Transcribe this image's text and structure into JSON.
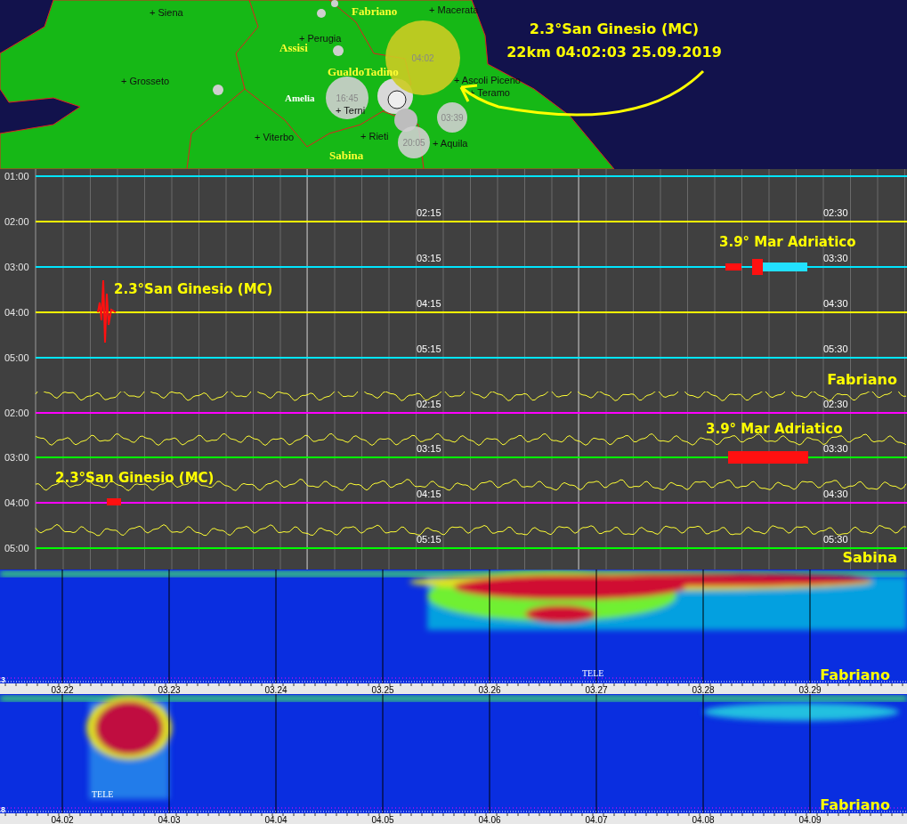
{
  "map": {
    "cities": [
      "+ Siena",
      "+ Macerata",
      "+ Perugia",
      "+ Grosseto",
      "+ Ascoli Piceno",
      "+ Teramo",
      "+ Viterbo",
      "+ Rieti",
      "+ Aquila",
      "+ Terni"
    ],
    "stations": [
      "Fabriano",
      "Assisi",
      "GualdoTadino",
      "Amelia",
      "Sabina"
    ],
    "bubbles": [
      {
        "time": "04:02",
        "kind": "latest"
      },
      {
        "time": "16:45",
        "kind": "past"
      },
      {
        "time": "03:39",
        "kind": "past"
      },
      {
        "time": "20:05",
        "kind": "past"
      }
    ],
    "callout": {
      "line1": "2.3°San Ginesio (MC)",
      "line2": "22km 04:02:03 25.09.2019"
    }
  },
  "helicorders": [
    {
      "station": "Fabriano",
      "wavy": false,
      "rows": [
        {
          "time": "01:00",
          "color": "#00e5ff"
        },
        {
          "time": "02:00",
          "mid": "02:15",
          "end": "02:30",
          "color": "#ffff00"
        },
        {
          "time": "03:00",
          "mid": "03:15",
          "end": "03:30",
          "color": "#00e5ff"
        },
        {
          "time": "04:00",
          "mid": "04:15",
          "end": "04:30",
          "color": "#ffff00"
        },
        {
          "time": "05:00",
          "mid": "05:15",
          "end": "05:30",
          "color": "#00e5ff"
        }
      ],
      "events": [
        "2.3°San Ginesio (MC)",
        "3.9° Mar Adriatico"
      ]
    },
    {
      "station": "Sabina",
      "wavy": true,
      "rows": [
        {
          "time": "02:00",
          "mid": "02:15",
          "end": "02:30",
          "color": "#ff00ff"
        },
        {
          "time": "03:00",
          "mid": "03:15",
          "end": "03:30",
          "color": "#00ff00"
        },
        {
          "time": "04:00",
          "mid": "04:15",
          "end": "04:30",
          "color": "#ff00ff"
        },
        {
          "time": "05:00",
          "mid": "05:15",
          "end": "05:30",
          "color": "#00ff00"
        }
      ],
      "events": [
        "3.9° Mar Adriatico",
        "2.3°San Ginesio (MC)"
      ]
    }
  ],
  "spectrograms": [
    {
      "station": "Fabriano",
      "marker": "TELE",
      "corner": "3",
      "axis_labels": [
        "03.22",
        "03.23",
        "03.24",
        "03.25",
        "03.26",
        "03.27",
        "03.28",
        "03.29"
      ]
    },
    {
      "station": "Fabriano",
      "marker": "TELE",
      "corner": "8",
      "axis_labels": [
        "04.02",
        "04.03",
        "04.04",
        "04.05",
        "04.06",
        "04.07",
        "04.08",
        "04.09"
      ]
    }
  ]
}
